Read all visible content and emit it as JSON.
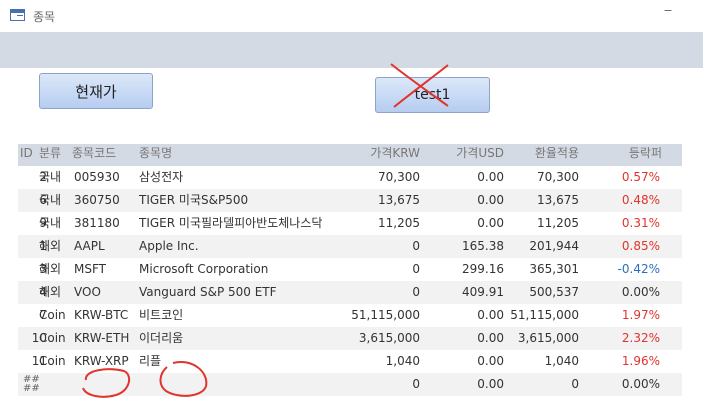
{
  "window": {
    "title": "종목",
    "minimize_glyph": "‒"
  },
  "buttons": {
    "current_price": "현재가",
    "test1": "test1"
  },
  "annotation_color": "#e0342c",
  "columns": {
    "id": "ID",
    "category": "분류",
    "code": "종목코드",
    "name": "종목명",
    "price_krw": "가격KRW",
    "price_usd": "가격USD",
    "converted": "환율적용",
    "change": "등락퍼"
  },
  "rows": [
    {
      "id": "2",
      "category": "국내",
      "code": "005930",
      "name": "삼성전자",
      "price_krw": "70,300",
      "price_usd": "0.00",
      "converted": "70,300",
      "change": "0.57%"
    },
    {
      "id": "6",
      "category": "국내",
      "code": "360750",
      "name": "TIGER 미국S&P500",
      "price_krw": "13,675",
      "price_usd": "0.00",
      "converted": "13,675",
      "change": "0.48%"
    },
    {
      "id": "9",
      "category": "국내",
      "code": "381180",
      "name": "TIGER 미국필라델피아반도체나스닥",
      "price_krw": "11,205",
      "price_usd": "0.00",
      "converted": "11,205",
      "change": "0.31%"
    },
    {
      "id": "1",
      "category": "해외",
      "code": "AAPL",
      "name": "Apple Inc.",
      "price_krw": "0",
      "price_usd": "165.38",
      "converted": "201,944",
      "change": "0.85%"
    },
    {
      "id": "3",
      "category": "해외",
      "code": "MSFT",
      "name": "Microsoft Corporation",
      "price_krw": "0",
      "price_usd": "299.16",
      "converted": "365,301",
      "change": "-0.42%"
    },
    {
      "id": "4",
      "category": "해외",
      "code": "VOO",
      "name": "Vanguard S&P 500 ETF",
      "price_krw": "0",
      "price_usd": "409.91",
      "converted": "500,537",
      "change": "0.00%"
    },
    {
      "id": "7",
      "category": "Coin",
      "code": "KRW-BTC",
      "name": "비트코인",
      "price_krw": "51,115,000",
      "price_usd": "0.00",
      "converted": "51,115,000",
      "change": "1.97%"
    },
    {
      "id": "10",
      "category": "Coin",
      "code": "KRW-ETH",
      "name": "이더리움",
      "price_krw": "3,615,000",
      "price_usd": "0.00",
      "converted": "3,615,000",
      "change": "2.32%"
    },
    {
      "id": "11",
      "category": "Coin",
      "code": "KRW-XRP",
      "name": "리플",
      "price_krw": "1,040",
      "price_usd": "0.00",
      "converted": "1,040",
      "change": "1.96%"
    }
  ],
  "new_row": {
    "marker": "##\n##",
    "price_krw": "0",
    "price_usd": "0.00",
    "converted": "0",
    "change": "0.00%"
  }
}
